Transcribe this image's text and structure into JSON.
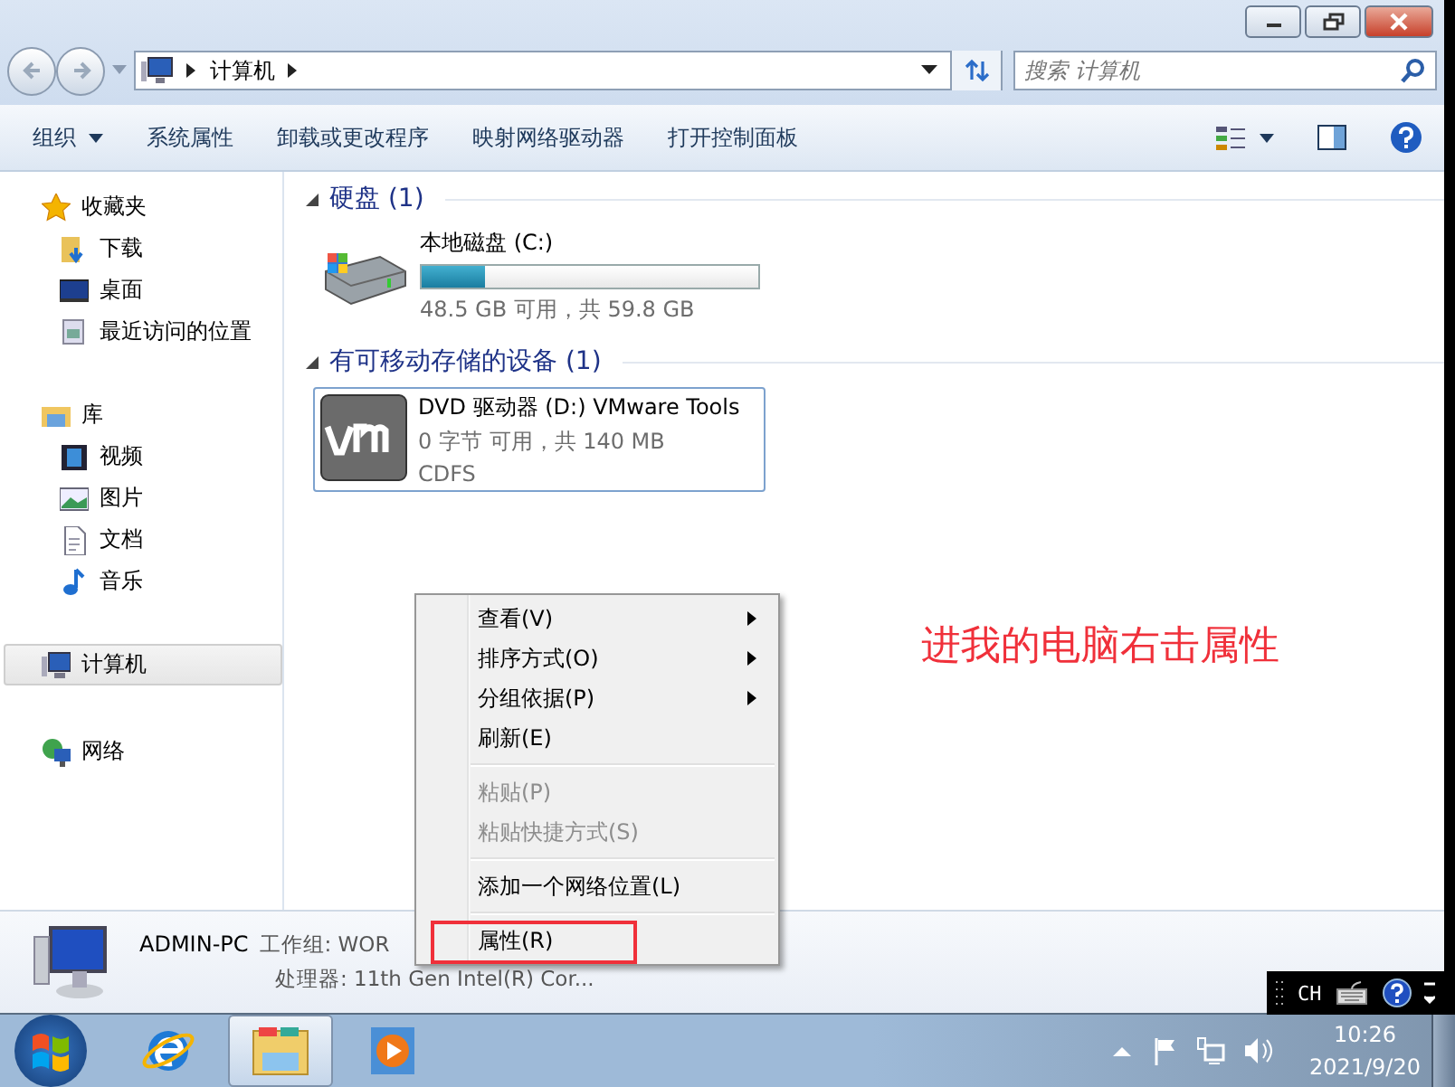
{
  "address": {
    "path": [
      "计算机"
    ]
  },
  "search": {
    "placeholder": "搜索 计算机"
  },
  "toolbar": [
    "组织",
    "系统属性",
    "卸载或更改程序",
    "映射网络驱动器",
    "打开控制面板"
  ],
  "sidebar": [
    {
      "label": "收藏夹",
      "selected": false,
      "children": [
        {
          "label": "下载",
          "selected": false
        },
        {
          "label": "桌面",
          "selected": false
        },
        {
          "label": "最近访问的位置",
          "selected": false
        }
      ]
    },
    {
      "label": "库",
      "selected": false,
      "children": [
        {
          "label": "视频",
          "selected": false
        },
        {
          "label": "图片",
          "selected": false
        },
        {
          "label": "文档",
          "selected": false
        },
        {
          "label": "音乐",
          "selected": false
        }
      ]
    },
    {
      "label": "计算机",
      "selected": true
    },
    {
      "label": "网络",
      "selected": false
    }
  ],
  "sections": [
    {
      "title": "硬盘 (1)",
      "items": [
        {
          "kind": "disk",
          "name": "本地磁盘 (C:)",
          "level": 0.19,
          "info": [
            "48.5 GB 可用，共 59.8 GB"
          ]
        }
      ]
    },
    {
      "title": "有可移动存储的设备 (1)",
      "items": [
        {
          "kind": "dvd",
          "name": "DVD 驱动器 (D:) VMware Tools",
          "info": [
            "0 字节 可用，共 140 MB",
            "CDFS"
          ]
        }
      ]
    }
  ],
  "context_menu": [
    {
      "kind": "item",
      "label": "查看(V)",
      "submenu": true,
      "disabled": false,
      "highlighted": false
    },
    {
      "kind": "item",
      "label": "排序方式(O)",
      "submenu": true,
      "disabled": false,
      "highlighted": false
    },
    {
      "kind": "item",
      "label": "分组依据(P)",
      "submenu": true,
      "disabled": false,
      "highlighted": false
    },
    {
      "kind": "item",
      "label": "刷新(E)",
      "submenu": false,
      "disabled": false,
      "highlighted": false
    },
    {
      "kind": "separator"
    },
    {
      "kind": "item",
      "label": "粘贴(P)",
      "submenu": false,
      "disabled": true,
      "highlighted": false
    },
    {
      "kind": "item",
      "label": "粘贴快捷方式(S)",
      "submenu": false,
      "disabled": true,
      "highlighted": false
    },
    {
      "kind": "separator"
    },
    {
      "kind": "item",
      "label": "添加一个网络位置(L)",
      "submenu": false,
      "disabled": false,
      "highlighted": false
    },
    {
      "kind": "separator"
    },
    {
      "kind": "item",
      "label": "属性(R)",
      "submenu": false,
      "disabled": false,
      "highlighted": true
    }
  ],
  "annotation": "进我的电脑右击属性",
  "details": {
    "name": "ADMIN-PC",
    "lines": [
      "工作组: WOR",
      "处理器: 11th Gen Intel(R) Cor..."
    ]
  },
  "language_bar": {
    "label": "CH"
  },
  "taskbar": [
    {
      "selected": false
    },
    {
      "selected": true
    },
    {
      "selected": false
    }
  ],
  "clock": {
    "time": "10:26",
    "date": "2021/9/20"
  }
}
